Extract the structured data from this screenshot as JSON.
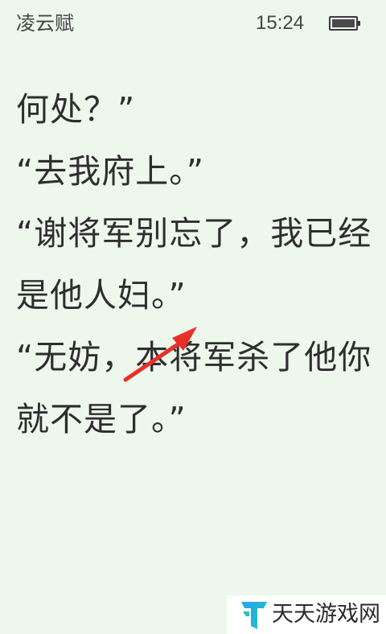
{
  "status_bar": {
    "book_title": "凌云赋",
    "time": "15:24",
    "battery_icon": "battery-icon"
  },
  "reader": {
    "lines": [
      "何处？”",
      "“去我府上。”",
      "“谢将军别忘了，我已经",
      "是他人妇。”",
      "“无妨，本将军杀了他你",
      "就不是了。”"
    ]
  },
  "annotation": {
    "icon": "red-arrow-icon",
    "color": "#e8302a"
  },
  "watermark": {
    "logo_icon": "tiantian-logo-icon",
    "text": "天天游戏网",
    "colors": [
      "#2aa7e8",
      "#1ec0c8"
    ]
  }
}
